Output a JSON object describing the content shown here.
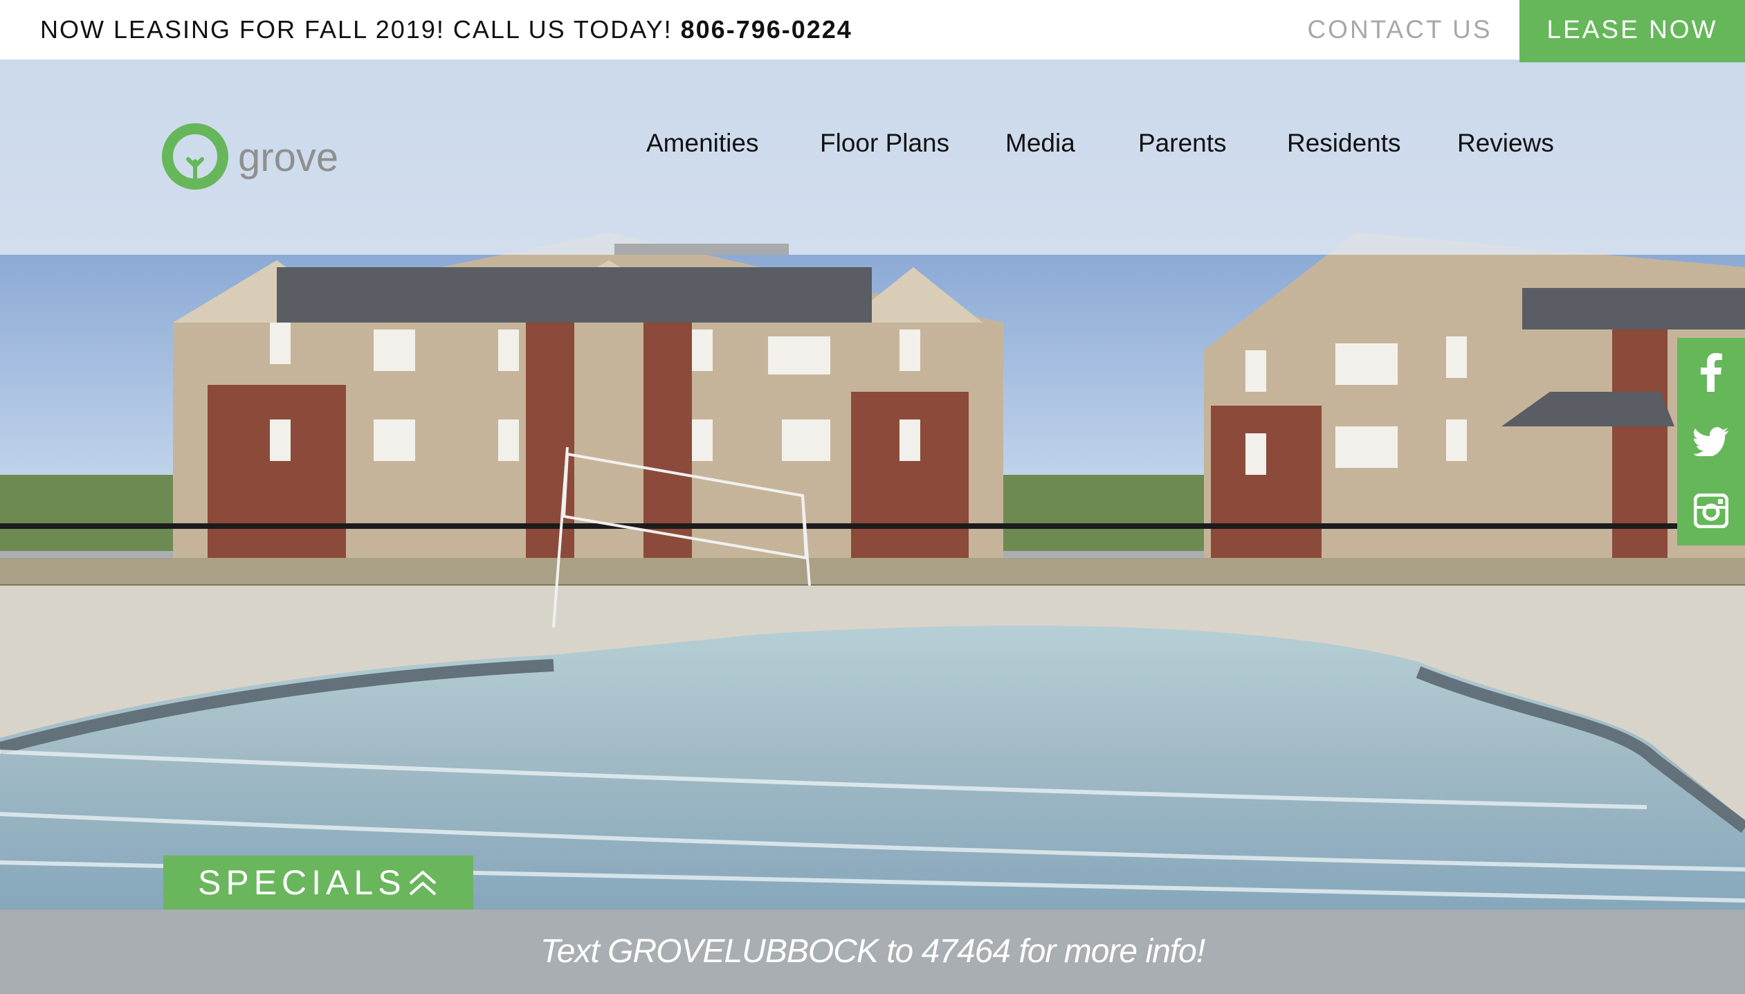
{
  "topbar": {
    "promo_text": "NOW LEASING FOR FALL 2019! CALL US TODAY!",
    "phone": "806-796-0224",
    "contact_label": "CONTACT US",
    "lease_label": "LEASE NOW"
  },
  "header": {
    "logo_text": "grove",
    "nav": [
      "Amenities",
      "Floor Plans",
      "Media",
      "Parents",
      "Residents",
      "Reviews"
    ],
    "active_nav_index": 0
  },
  "social": {
    "icons": [
      "facebook-icon",
      "twitter-icon",
      "instagram-icon"
    ]
  },
  "specials": {
    "label": "SPECIALS"
  },
  "footer_banner": {
    "text": "Text GROVELUBBOCK to 47464 for more info!"
  },
  "colors": {
    "brand_green": "#66b75a",
    "banner_gray": "#a9aeb2",
    "header_overlay": "#dde7f1"
  }
}
